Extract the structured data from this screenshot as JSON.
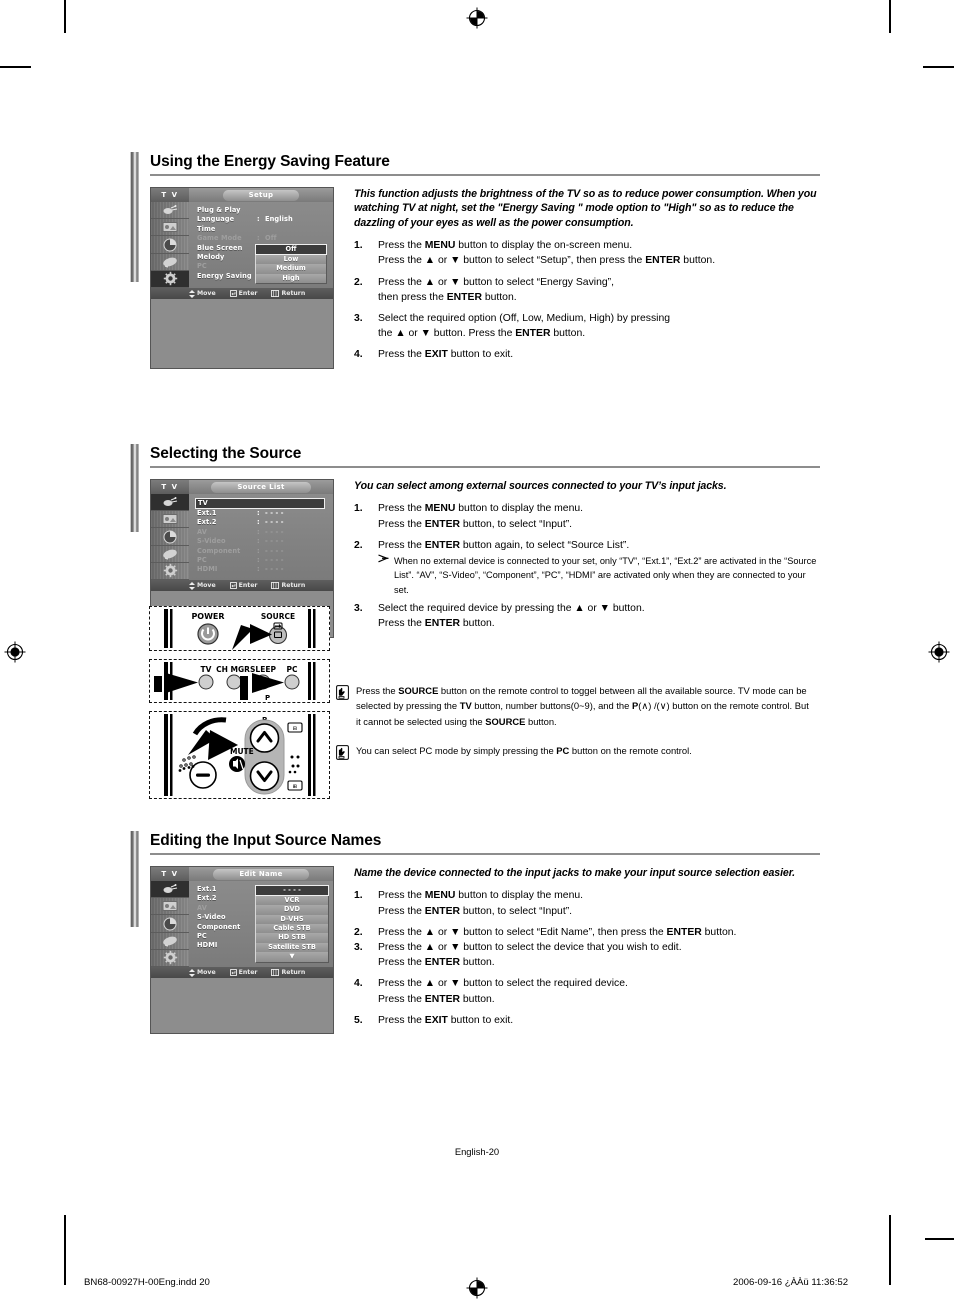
{
  "page": {
    "page_number_label": "English-20",
    "footer_left": "BN68-00927H-00Eng.indd   20",
    "footer_right": "2006-09-16   ¿ÀÀü 11:36:52"
  },
  "sections": [
    {
      "title": "Using the Energy Saving Feature",
      "osd": {
        "header_left": "T V",
        "header_title": "Setup",
        "rows": [
          {
            "label": "Plug & Play",
            "colon": "",
            "value": "",
            "dim": false
          },
          {
            "label": "Language",
            "colon": ":",
            "value": "English",
            "dim": false
          },
          {
            "label": "Time",
            "colon": "",
            "value": "",
            "dim": false
          },
          {
            "label": "Game Mode",
            "colon": ":",
            "value": "Off",
            "dim": true
          },
          {
            "label": "Blue Screen",
            "colon": ":",
            "value": "",
            "dim": false
          },
          {
            "label": "Melody",
            "colon": ":",
            "value": "",
            "dim": false
          },
          {
            "label": "PC",
            "colon": "",
            "value": "",
            "dim": true
          },
          {
            "label": "Energy Saving",
            "colon": ":",
            "value": "",
            "dim": false
          }
        ],
        "options": [
          "Off",
          "Low",
          "Medium",
          "High"
        ],
        "footer": {
          "move": "Move",
          "enter": "Enter",
          "return": "Return"
        }
      },
      "intro": "This function adjusts the brightness of the TV so as to reduce power consumption. When you watching TV at night, set the  \"Energy Saving \" mode option to \"High\" so as to reduce the dazzling of your eyes as well as the power consumption.",
      "steps": [
        {
          "num": "1.",
          "lines": [
            "Press the <b>MENU</b> button to display the on-screen menu.",
            "Press the ▲ or ▼ button to select “Setup”, then press the <b>ENTER</b> button."
          ]
        },
        {
          "num": "2.",
          "lines": [
            "Press the ▲ or ▼ button to select “Energy Saving”,",
            "then press the <b>ENTER</b> button."
          ]
        },
        {
          "num": "3.",
          "lines": [
            "Select the required option (Off, Low, Medium, High) by pressing",
            "the ▲ or ▼ button. Press the <b>ENTER</b> button."
          ]
        },
        {
          "num": "4.",
          "lines": [
            "Press the <b>EXIT</b> button to exit."
          ]
        }
      ]
    },
    {
      "title": "Selecting the Source",
      "osd": {
        "header_left": "T V",
        "header_title": "Source List",
        "rows": [
          {
            "label": "TV",
            "colon": "",
            "value": "",
            "dim": false,
            "highlight": true
          },
          {
            "label": "Ext.1",
            "colon": ":",
            "value": "- - - -",
            "dim": false
          },
          {
            "label": "Ext.2",
            "colon": ":",
            "value": "- - - -",
            "dim": false
          },
          {
            "label": "AV",
            "colon": ":",
            "value": "- - - -",
            "dim": true
          },
          {
            "label": "S-Video",
            "colon": ":",
            "value": "- - - -",
            "dim": true
          },
          {
            "label": "Component",
            "colon": ":",
            "value": "- - - -",
            "dim": true
          },
          {
            "label": "PC",
            "colon": ":",
            "value": "- - - -",
            "dim": true
          },
          {
            "label": "HDMI",
            "colon": ":",
            "value": "- - - -",
            "dim": true
          }
        ],
        "options": [],
        "footer": {
          "move": "Move",
          "enter": "Enter",
          "return": "Return"
        }
      },
      "intro": "You can select among external sources connected to your TV’s input jacks.",
      "steps": [
        {
          "num": "1.",
          "lines": [
            "Press the <b>MENU</b> button to display the menu.",
            "Press the <b>ENTER</b> button, to select “Input”."
          ]
        },
        {
          "num": "2.",
          "lines": [
            "Press the <b>ENTER</b> button again, to select “Source List”."
          ]
        },
        {
          "num": "3.",
          "lines": [
            "Select the required device by pressing the ▲ or ▼ button.",
            "Press the <b>ENTER</b> button."
          ]
        }
      ],
      "subnote": "When no external device is connected to your set, only “TV”, “Ext.1”, “Ext.2” are activated in the “Source List”. “AV”, “S-Video”, “Component”, “PC”, “HDMI” are activated only when they are connected to your set.",
      "notes": [
        "Press the <b>SOURCE</b> button on the remote control to toggel between all the available source. TV mode can be selected by pressing the <b>TV</b> button, number buttons(0~9), and the <b>P</b>(∧) /(∨) button on the remote control. But it cannot be selected using the <b>SOURCE</b> button.",
        "You can select PC mode by simply pressing the  <b>PC</b> button on the remote control."
      ],
      "remote_labels": {
        "power": "POWER",
        "source": "SOURCE",
        "tv": "TV",
        "ch_mgr": "CH MGR",
        "sleep": "SLEEP",
        "pc": "PC",
        "p": "P",
        "mute": "MUTE"
      }
    },
    {
      "title": "Editing the Input Source Names",
      "osd": {
        "header_left": "T V",
        "header_title": "Edit Name",
        "rows": [
          {
            "label": "Ext.1",
            "colon": ":",
            "value": "",
            "dim": false
          },
          {
            "label": "Ext.2",
            "colon": ":",
            "value": "",
            "dim": false
          },
          {
            "label": "AV",
            "colon": ":",
            "value": "",
            "dim": true
          },
          {
            "label": "S-Video",
            "colon": ":",
            "value": "",
            "dim": false
          },
          {
            "label": "Component",
            "colon": ":",
            "value": "",
            "dim": false
          },
          {
            "label": "PC",
            "colon": ":",
            "value": "",
            "dim": false
          },
          {
            "label": "HDMI",
            "colon": ":",
            "value": "",
            "dim": false
          }
        ],
        "options": [
          "- - - -",
          "VCR",
          "DVD",
          "D-VHS",
          "Cable STB",
          "HD STB",
          "Satellite STB",
          "▼"
        ],
        "footer": {
          "move": "Move",
          "enter": "Enter",
          "return": "Return"
        }
      },
      "intro": "Name the device connected to the input jacks to make your input source selection easier.",
      "steps": [
        {
          "num": "1.",
          "lines": [
            "Press the <b>MENU</b> button to display the menu.",
            "Press the <b>ENTER</b> button, to select “Input”."
          ]
        },
        {
          "num": "2.",
          "lines": [
            "Press the ▲ or ▼ button to select “Edit Name”, then press the <b>ENTER</b> button."
          ]
        },
        {
          "num": "3.",
          "lines": [
            "Press the ▲ or ▼ button to select the device that you wish to edit.",
            "Press the <b>ENTER</b>  button."
          ]
        },
        {
          "num": "4.",
          "lines": [
            "Press the ▲ or ▼ button to select the required device.",
            "Press the <b>ENTER</b> button."
          ]
        },
        {
          "num": "5.",
          "lines": [
            "Press the <b>EXIT</b> button to exit."
          ]
        }
      ]
    }
  ]
}
